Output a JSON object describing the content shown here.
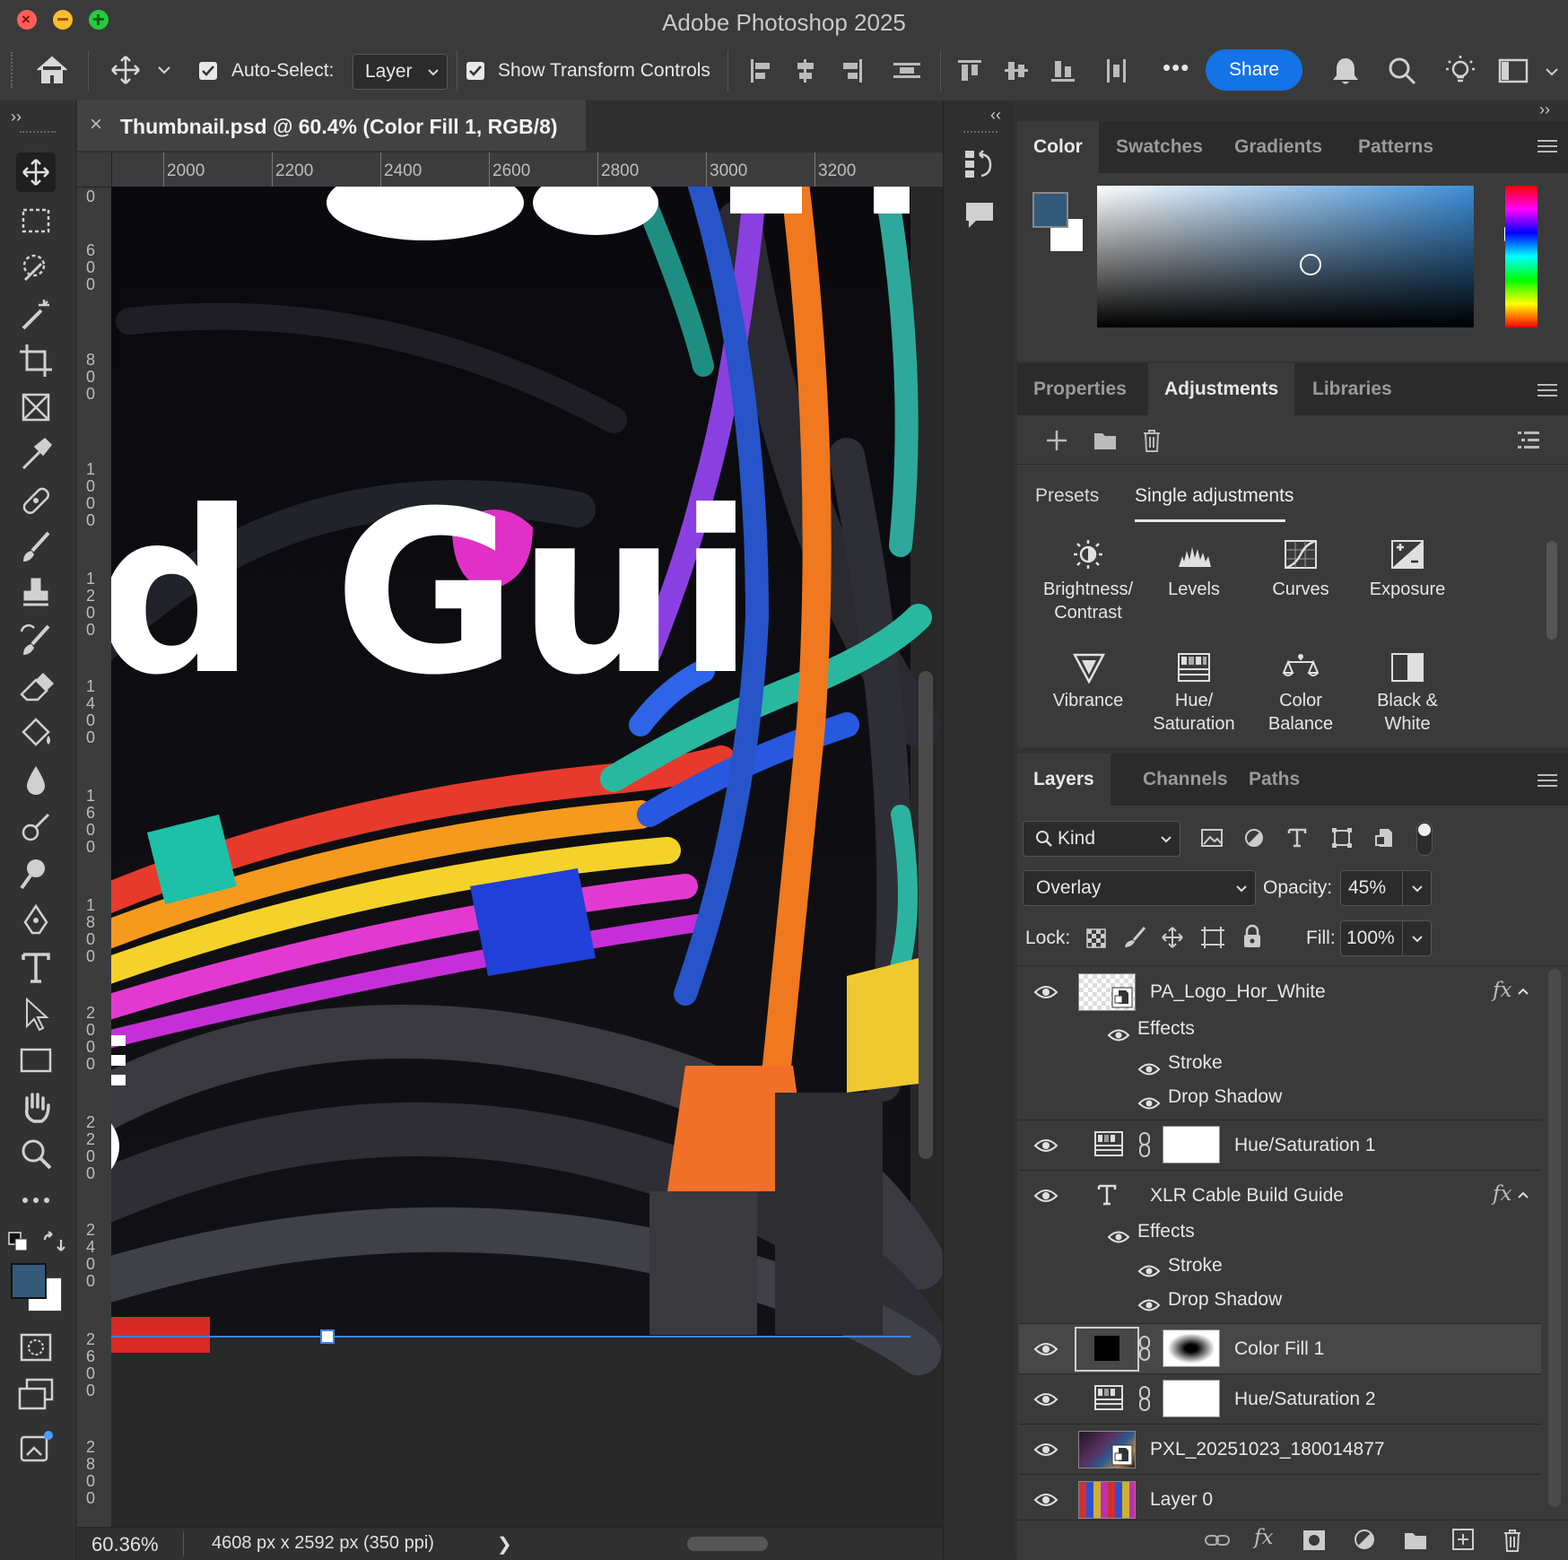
{
  "app": {
    "title": "Adobe Photoshop 2025"
  },
  "options": {
    "auto_select_label": "Auto-Select:",
    "auto_select_value": "Layer",
    "show_transform_label": "Show Transform Controls",
    "more": "•••",
    "share_label": "Share"
  },
  "document": {
    "tab_title": "Thumbnail.psd @ 60.4% (Color Fill 1, RGB/8)",
    "close": "×",
    "ruler_h": [
      "2000",
      "2200",
      "2400",
      "2600",
      "2800",
      "3000",
      "3200"
    ],
    "ruler_v": [
      "0",
      "600",
      "800",
      "1000",
      "1200",
      "1400",
      "1600",
      "1800",
      "2000",
      "2200",
      "2400",
      "2600",
      "2800"
    ],
    "canvas_text": "d Gui",
    "zoom": "60.36%",
    "doc_info": "4608 px x 2592 px (350 ppi)",
    "status_arrow": "❯"
  },
  "color_panel": {
    "tabs": [
      "Color",
      "Swatches",
      "Gradients",
      "Patterns"
    ],
    "foreground": "#345a7a",
    "background": "#ffffff"
  },
  "adjust_panel": {
    "tabs": [
      "Properties",
      "Adjustments",
      "Libraries"
    ],
    "subtabs": [
      "Presets",
      "Single adjustments"
    ],
    "items": [
      {
        "label": "Brightness/\nContrast",
        "icon": "brightness-icon"
      },
      {
        "label": "Levels",
        "icon": "levels-icon"
      },
      {
        "label": "Curves",
        "icon": "curves-icon"
      },
      {
        "label": "Exposure",
        "icon": "exposure-icon"
      },
      {
        "label": "Vibrance",
        "icon": "vibrance-icon"
      },
      {
        "label": "Hue/\nSaturation",
        "icon": "hue-saturation-icon"
      },
      {
        "label": "Color\nBalance",
        "icon": "color-balance-icon"
      },
      {
        "label": "Black &\nWhite",
        "icon": "black-white-icon"
      }
    ]
  },
  "layers_panel": {
    "tabs": [
      "Layers",
      "Channels",
      "Paths"
    ],
    "filter": "Kind",
    "blend_mode": "Overlay",
    "opacity_label": "Opacity:",
    "opacity": "45%",
    "lock_label": "Lock:",
    "fill_label": "Fill:",
    "fill": "100%",
    "effects_label": "Effects",
    "stroke_label": "Stroke",
    "drop_shadow_label": "Drop Shadow",
    "fx": "fx",
    "layers": [
      {
        "name": "PA_Logo_Hor_White"
      },
      {
        "name": "Hue/Saturation 1"
      },
      {
        "name": "XLR Cable Build Guide"
      },
      {
        "name": "Color Fill 1",
        "selected": true
      },
      {
        "name": "Hue/Saturation 2"
      },
      {
        "name": "PXL_20251023_180014877"
      },
      {
        "name": "Layer 0"
      }
    ]
  }
}
